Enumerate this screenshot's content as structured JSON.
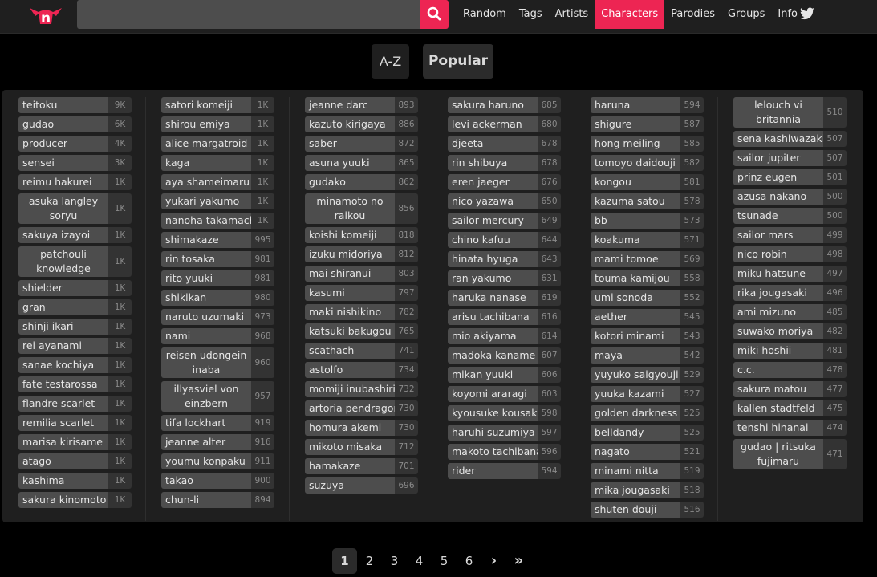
{
  "nav": {
    "logo_text": "n",
    "search_placeholder": "",
    "menu": [
      "Random",
      "Tags",
      "Artists",
      "Characters",
      "Parodies",
      "Groups",
      "Info"
    ],
    "active": "Characters",
    "accent_color": "#ed2553"
  },
  "sort": {
    "az_label": "A-Z",
    "popular_label": "Popular",
    "active": "Popular"
  },
  "columns": [
    [
      {
        "name": "teitoku",
        "count": "9K"
      },
      {
        "name": "gudao",
        "count": "6K"
      },
      {
        "name": "producer",
        "count": "4K"
      },
      {
        "name": "sensei",
        "count": "3K"
      },
      {
        "name": "reimu hakurei",
        "count": "1K"
      },
      {
        "name": "asuka langley soryu",
        "count": "1K"
      },
      {
        "name": "sakuya izayoi",
        "count": "1K"
      },
      {
        "name": "patchouli knowledge",
        "count": "1K"
      },
      {
        "name": "shielder",
        "count": "1K"
      },
      {
        "name": "gran",
        "count": "1K"
      },
      {
        "name": "shinji ikari",
        "count": "1K"
      },
      {
        "name": "rei ayanami",
        "count": "1K"
      },
      {
        "name": "sanae kochiya",
        "count": "1K"
      },
      {
        "name": "fate testarossa",
        "count": "1K"
      },
      {
        "name": "flandre scarlet",
        "count": "1K"
      },
      {
        "name": "remilia scarlet",
        "count": "1K"
      },
      {
        "name": "marisa kirisame",
        "count": "1K"
      },
      {
        "name": "atago",
        "count": "1K"
      },
      {
        "name": "kashima",
        "count": "1K"
      },
      {
        "name": "sakura kinomoto",
        "count": "1K"
      }
    ],
    [
      {
        "name": "satori komeiji",
        "count": "1K"
      },
      {
        "name": "shirou emiya",
        "count": "1K"
      },
      {
        "name": "alice margatroid",
        "count": "1K"
      },
      {
        "name": "kaga",
        "count": "1K"
      },
      {
        "name": "aya shameimaru",
        "count": "1K"
      },
      {
        "name": "yukari yakumo",
        "count": "1K"
      },
      {
        "name": "nanoha takamachi",
        "count": "1K"
      },
      {
        "name": "shimakaze",
        "count": "995"
      },
      {
        "name": "rin tosaka",
        "count": "981"
      },
      {
        "name": "rito yuuki",
        "count": "981"
      },
      {
        "name": "shikikan",
        "count": "980"
      },
      {
        "name": "naruto uzumaki",
        "count": "973"
      },
      {
        "name": "nami",
        "count": "968"
      },
      {
        "name": "reisen udongein inaba",
        "count": "960"
      },
      {
        "name": "illyasviel von einzbern",
        "count": "957"
      },
      {
        "name": "tifa lockhart",
        "count": "919"
      },
      {
        "name": "jeanne alter",
        "count": "916"
      },
      {
        "name": "youmu konpaku",
        "count": "911"
      },
      {
        "name": "takao",
        "count": "900"
      },
      {
        "name": "chun-li",
        "count": "894"
      }
    ],
    [
      {
        "name": "jeanne darc",
        "count": "893"
      },
      {
        "name": "kazuto kirigaya",
        "count": "886"
      },
      {
        "name": "saber",
        "count": "872"
      },
      {
        "name": "asuna yuuki",
        "count": "865"
      },
      {
        "name": "gudako",
        "count": "862"
      },
      {
        "name": "minamoto no raikou",
        "count": "856"
      },
      {
        "name": "koishi komeiji",
        "count": "818"
      },
      {
        "name": "izuku midoriya",
        "count": "812"
      },
      {
        "name": "mai shiranui",
        "count": "803"
      },
      {
        "name": "kasumi",
        "count": "797"
      },
      {
        "name": "maki nishikino",
        "count": "782"
      },
      {
        "name": "katsuki bakugou",
        "count": "765"
      },
      {
        "name": "scathach",
        "count": "741"
      },
      {
        "name": "astolfo",
        "count": "734"
      },
      {
        "name": "momiji inubashiri",
        "count": "732"
      },
      {
        "name": "artoria pendragon",
        "count": "730"
      },
      {
        "name": "homura akemi",
        "count": "730"
      },
      {
        "name": "mikoto misaka",
        "count": "712"
      },
      {
        "name": "hamakaze",
        "count": "701"
      },
      {
        "name": "suzuya",
        "count": "696"
      }
    ],
    [
      {
        "name": "sakura haruno",
        "count": "685"
      },
      {
        "name": "levi ackerman",
        "count": "680"
      },
      {
        "name": "djeeta",
        "count": "678"
      },
      {
        "name": "rin shibuya",
        "count": "678"
      },
      {
        "name": "eren jaeger",
        "count": "676"
      },
      {
        "name": "nico yazawa",
        "count": "650"
      },
      {
        "name": "sailor mercury",
        "count": "649"
      },
      {
        "name": "chino kafuu",
        "count": "644"
      },
      {
        "name": "hinata hyuga",
        "count": "643"
      },
      {
        "name": "ran yakumo",
        "count": "631"
      },
      {
        "name": "haruka nanase",
        "count": "619"
      },
      {
        "name": "arisu tachibana",
        "count": "616"
      },
      {
        "name": "mio akiyama",
        "count": "614"
      },
      {
        "name": "madoka kaname",
        "count": "607"
      },
      {
        "name": "mikan yuuki",
        "count": "606"
      },
      {
        "name": "koyomi araragi",
        "count": "603"
      },
      {
        "name": "kyousuke kousaka",
        "count": "598"
      },
      {
        "name": "haruhi suzumiya",
        "count": "597"
      },
      {
        "name": "makoto tachibana",
        "count": "596"
      },
      {
        "name": "rider",
        "count": "594"
      }
    ],
    [
      {
        "name": "haruna",
        "count": "594"
      },
      {
        "name": "shigure",
        "count": "587"
      },
      {
        "name": "hong meiling",
        "count": "585"
      },
      {
        "name": "tomoyo daidouji",
        "count": "582"
      },
      {
        "name": "kongou",
        "count": "581"
      },
      {
        "name": "kazuma satou",
        "count": "578"
      },
      {
        "name": "bb",
        "count": "573"
      },
      {
        "name": "koakuma",
        "count": "571"
      },
      {
        "name": "mami tomoe",
        "count": "569"
      },
      {
        "name": "touma kamijou",
        "count": "558"
      },
      {
        "name": "umi sonoda",
        "count": "552"
      },
      {
        "name": "aether",
        "count": "545"
      },
      {
        "name": "kotori minami",
        "count": "543"
      },
      {
        "name": "maya",
        "count": "542"
      },
      {
        "name": "yuyuko saigyouji",
        "count": "529"
      },
      {
        "name": "yuuka kazami",
        "count": "527"
      },
      {
        "name": "golden darkness",
        "count": "525"
      },
      {
        "name": "belldandy",
        "count": "525"
      },
      {
        "name": "nagato",
        "count": "521"
      },
      {
        "name": "minami nitta",
        "count": "519"
      },
      {
        "name": "mika jougasaki",
        "count": "518"
      },
      {
        "name": "shuten douji",
        "count": "516"
      }
    ],
    [
      {
        "name": "lelouch vi britannia",
        "count": "510"
      },
      {
        "name": "sena kashiwazaki",
        "count": "507"
      },
      {
        "name": "sailor jupiter",
        "count": "507"
      },
      {
        "name": "prinz eugen",
        "count": "501"
      },
      {
        "name": "azusa nakano",
        "count": "500"
      },
      {
        "name": "tsunade",
        "count": "500"
      },
      {
        "name": "sailor mars",
        "count": "499"
      },
      {
        "name": "nico robin",
        "count": "498"
      },
      {
        "name": "miku hatsune",
        "count": "497"
      },
      {
        "name": "rika jougasaki",
        "count": "496"
      },
      {
        "name": "ami mizuno",
        "count": "485"
      },
      {
        "name": "suwako moriya",
        "count": "482"
      },
      {
        "name": "miki hoshii",
        "count": "481"
      },
      {
        "name": "c.c.",
        "count": "478"
      },
      {
        "name": "sakura matou",
        "count": "477"
      },
      {
        "name": "kallen stadtfeld",
        "count": "475"
      },
      {
        "name": "tenshi hinanai",
        "count": "474"
      },
      {
        "name": "gudao | ritsuka fujimaru",
        "count": "471"
      }
    ]
  ],
  "pagination": {
    "pages": [
      "1",
      "2",
      "3",
      "4",
      "5",
      "6"
    ],
    "current": "1",
    "next": "›",
    "last": "»"
  }
}
